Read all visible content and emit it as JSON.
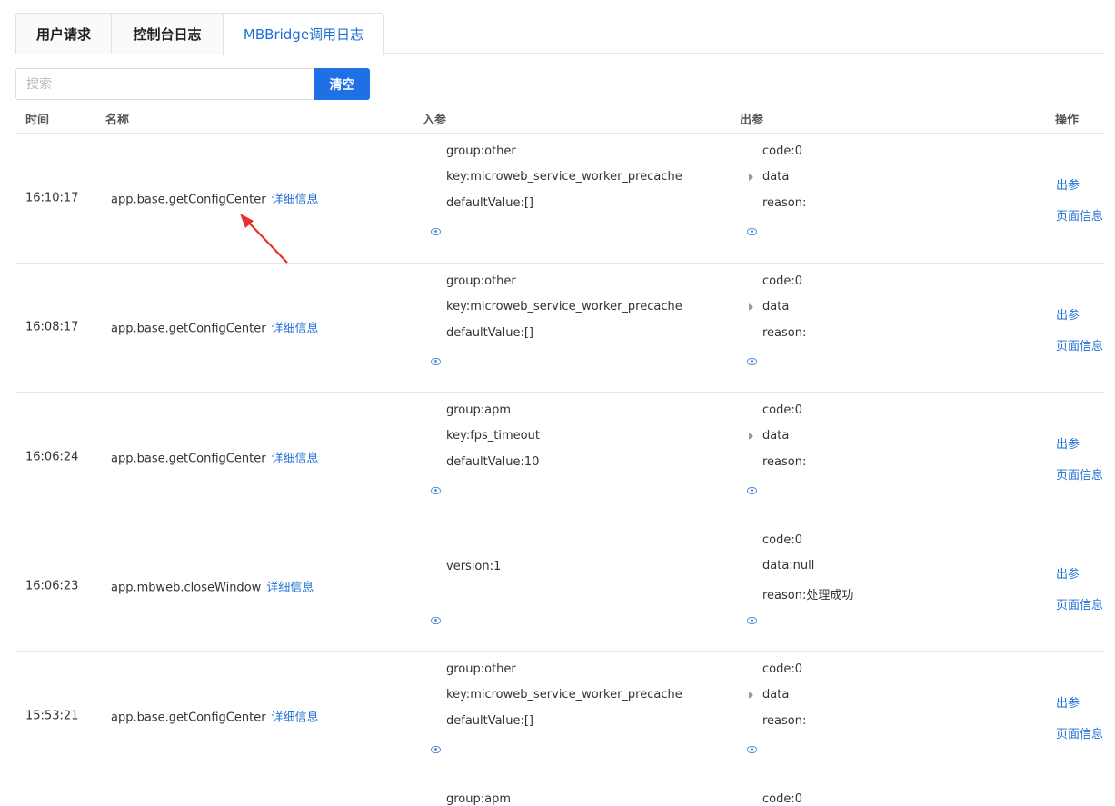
{
  "tabs": [
    {
      "label": "用户请求"
    },
    {
      "label": "控制台日志"
    },
    {
      "label": "MBBridge调用日志"
    }
  ],
  "search": {
    "placeholder": "搜索",
    "value": ""
  },
  "clear_button": "清空",
  "columns": {
    "time": "时间",
    "name": "名称",
    "input": "入参",
    "output": "出参",
    "actions": "操作"
  },
  "detail_label": "详细信息",
  "actions": {
    "output": "出参",
    "page_info": "页面信息"
  },
  "rows": [
    {
      "time": "16:10:17",
      "name": "app.base.getConfigCenter",
      "params": [
        "group:other",
        "key:microweb_service_worker_precache",
        "defaultValue:[]"
      ],
      "outputs": [
        "code:0",
        "data",
        "reason:"
      ],
      "data_expandable": true
    },
    {
      "time": "16:08:17",
      "name": "app.base.getConfigCenter",
      "params": [
        "group:other",
        "key:microweb_service_worker_precache",
        "defaultValue:[]"
      ],
      "outputs": [
        "code:0",
        "data",
        "reason:"
      ],
      "data_expandable": true
    },
    {
      "time": "16:06:24",
      "name": "app.base.getConfigCenter",
      "params": [
        "group:apm",
        "key:fps_timeout",
        "defaultValue:10"
      ],
      "outputs": [
        "code:0",
        "data",
        "reason:"
      ],
      "data_expandable": true
    },
    {
      "time": "16:06:23",
      "name": "app.mbweb.closeWindow",
      "params": [
        "version:1"
      ],
      "outputs": [
        "code:0",
        "data:null",
        "reason:处理成功"
      ],
      "data_expandable": false
    },
    {
      "time": "15:53:21",
      "name": "app.base.getConfigCenter",
      "params": [
        "group:other",
        "key:microweb_service_worker_precache",
        "defaultValue:[]"
      ],
      "outputs": [
        "code:0",
        "data",
        "reason:"
      ],
      "data_expandable": true
    },
    {
      "time": "",
      "name": "",
      "params": [
        "group:apm"
      ],
      "outputs": [
        "code:0"
      ],
      "data_expandable": false,
      "partial": true
    }
  ],
  "colors": {
    "accent": "#1f6fe5",
    "link": "#1f6fd6",
    "annotation_arrow": "#e8312a"
  }
}
